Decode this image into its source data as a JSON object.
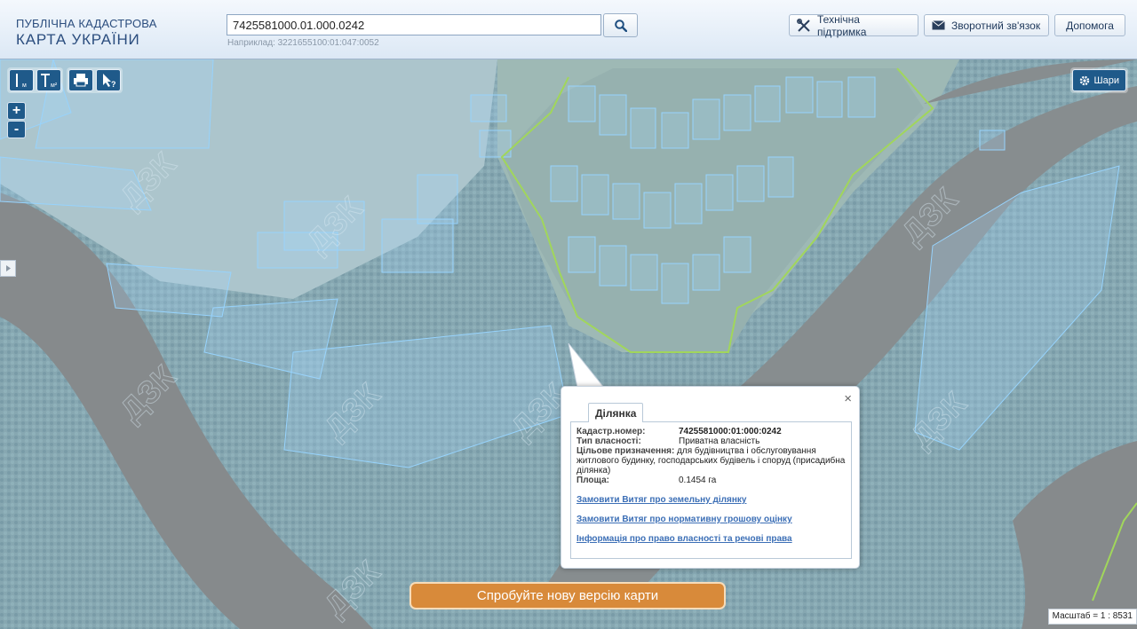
{
  "header": {
    "logo_line1": "ПУБЛІЧНА КАДАСТРОВА",
    "logo_line2": "КАРТА УКРАЇНИ",
    "search_value": "7425581000.01.000.0242",
    "search_hint": "Наприклад: 3221655100:01:047:0052",
    "support_label": "Технічна підтримка",
    "feedback_label": "Зворотний зв'язок",
    "help_label": "Допомога"
  },
  "map": {
    "layers_label": "Шари",
    "zoom_in": "+",
    "zoom_out": "-",
    "cta_label": "Спробуйте нову версію карти",
    "scale_text": "Масштаб = 1 : 8531",
    "watermark": "ДЗК"
  },
  "popup": {
    "close": "×",
    "tab_label": "Ділянка",
    "cadastral_label": "Кадастр.номер:",
    "cadastral_value": "7425581000:01:000:0242",
    "ownership_label": "Тип власності:",
    "ownership_value": "Приватна власність",
    "purpose_label": "Цільове призначення:",
    "purpose_value": "для будівництва і обслуговування житлового будинку, господарських будівель і споруд (присадибна ділянка)",
    "area_label": "Площа:",
    "area_value": "0.1454 га",
    "link_extract": "Замовити Витяг про земельну ділянку",
    "link_valuation": "Замовити Витяг про нормативну грошову оцінку",
    "link_rights": "Інформація про право власності та речові права"
  },
  "colors": {
    "header_text": "#2b4d7e",
    "tool_blue": "#1f5a8a",
    "cta_orange": "#d88a3a",
    "parcel_stroke": "#8fd0ff",
    "boundary_green": "#9bd43a",
    "link_blue": "#3c6fb6"
  },
  "icons": {
    "search": "magnifier-icon",
    "support": "tools-icon",
    "feedback": "envelope-icon",
    "layers": "gear-icon",
    "print": "printer-icon",
    "identify": "cursor-question-icon"
  }
}
